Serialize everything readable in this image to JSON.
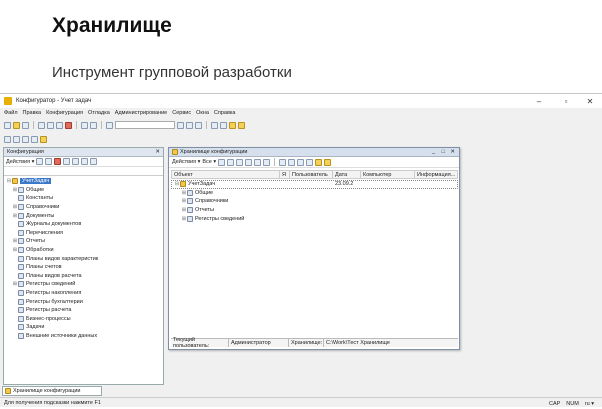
{
  "slide": {
    "title": "Хранилище",
    "subtitle": "Инструмент групповой разработки"
  },
  "window": {
    "title": "Конфигуратор - Учет задач",
    "minimize": "–",
    "restore": "▫",
    "close": "✕"
  },
  "menu": [
    "Файл",
    "Правка",
    "Конфигурация",
    "Отладка",
    "Администрирование",
    "Сервис",
    "Окна",
    "Справка"
  ],
  "left_panel": {
    "title": "Конфигурация",
    "close": "✕",
    "actions_label": "Действия ▾",
    "tree": [
      {
        "label": "УчетЗадач",
        "level": 0,
        "exp": "⊟",
        "sel": true
      },
      {
        "label": "Общие",
        "level": 1,
        "exp": "⊞"
      },
      {
        "label": "Константы",
        "level": 1,
        "exp": ""
      },
      {
        "label": "Справочники",
        "level": 1,
        "exp": "⊞"
      },
      {
        "label": "Документы",
        "level": 1,
        "exp": "⊞"
      },
      {
        "label": "Журналы документов",
        "level": 1,
        "exp": ""
      },
      {
        "label": "Перечисления",
        "level": 1,
        "exp": ""
      },
      {
        "label": "Отчеты",
        "level": 1,
        "exp": "⊞"
      },
      {
        "label": "Обработки",
        "level": 1,
        "exp": "⊞"
      },
      {
        "label": "Планы видов характеристик",
        "level": 1,
        "exp": ""
      },
      {
        "label": "Планы счетов",
        "level": 1,
        "exp": ""
      },
      {
        "label": "Планы видов расчета",
        "level": 1,
        "exp": ""
      },
      {
        "label": "Регистры сведений",
        "level": 1,
        "exp": "⊞"
      },
      {
        "label": "Регистры накопления",
        "level": 1,
        "exp": ""
      },
      {
        "label": "Регистры бухгалтерии",
        "level": 1,
        "exp": ""
      },
      {
        "label": "Регистры расчета",
        "level": 1,
        "exp": ""
      },
      {
        "label": "Бизнес-процессы",
        "level": 1,
        "exp": ""
      },
      {
        "label": "Задачи",
        "level": 1,
        "exp": ""
      },
      {
        "label": "Внешние источники данных",
        "level": 1,
        "exp": ""
      }
    ]
  },
  "repo": {
    "title": "Хранилище конфигурации",
    "min": "_",
    "max": "□",
    "close": "✕",
    "actions": "Действия ▾",
    "all": "Все ▾",
    "columns": [
      "Объект",
      "Я",
      "Пользователь",
      "Дата",
      "Компьютер",
      "Информация..."
    ],
    "rows": [
      {
        "name": "УчетЗадач",
        "level": 0,
        "exp": "⊟",
        "date": "23.09.2"
      },
      {
        "name": "Общие",
        "level": 1,
        "exp": "⊞",
        "date": ""
      },
      {
        "name": "Справочники",
        "level": 1,
        "exp": "⊞",
        "date": ""
      },
      {
        "name": "Отчеты",
        "level": 1,
        "exp": "⊞",
        "date": ""
      },
      {
        "name": "Регистры сведений",
        "level": 1,
        "exp": "⊞",
        "date": ""
      }
    ],
    "status": {
      "user_label": "Текущий пользователь:",
      "user": "Администратор",
      "repo_label": "Хранилище:",
      "repo_path": "C:\\Work\\Тест Хранилище"
    }
  },
  "bottom_tab": "Хранилище конфигурации",
  "statusbar": {
    "hint": "Для получения подсказки нажмите F1",
    "cap": "CAP",
    "num": "NUM",
    "lang": "ru ▾"
  }
}
